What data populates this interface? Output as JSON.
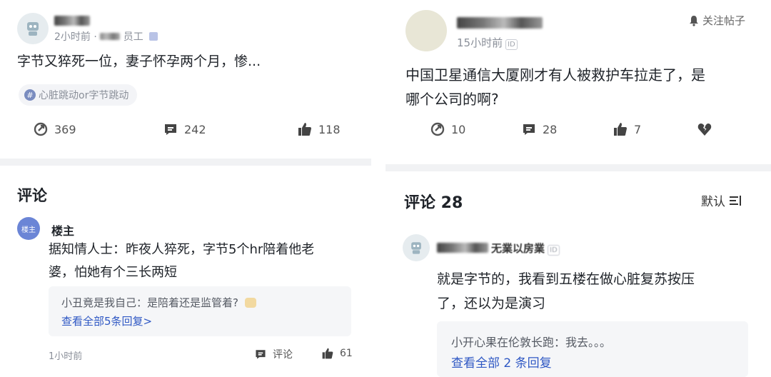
{
  "left_post": {
    "author_suffix": "员工",
    "time_prefix": "2小时前 ·",
    "content": "字节又猝死一位，妻子怀孕两个月，惨...",
    "tag": "心脏跳动or字节跳动",
    "stats": {
      "views": "369",
      "comments": "242",
      "likes": "118"
    }
  },
  "left_comments": {
    "heading": "评论",
    "op_avatar_label": "楼主",
    "op_name": "楼主",
    "op_text_line1": "据知情人士：昨夜人猝死，字节5个hr陪着他老",
    "op_text_line2": "婆，怕她有个三长两短",
    "reply": "小丑竟是我自己：是陪着还是监管着?",
    "view_all": "查看全部5条回复>",
    "time": "1小时前",
    "comment_label": "评论",
    "likes": "61"
  },
  "right_post": {
    "follow_label": "关注帖子",
    "time": "15小时前",
    "id_badge": "ID",
    "content_line1": "中国卫星通信大厦刚才有人被救护车拉走了，是",
    "content_line2": "哪个公司的啊?",
    "stats": {
      "views": "10",
      "comments": "28",
      "likes": "7"
    }
  },
  "right_comments": {
    "heading": "评论 28",
    "sort_label": "默认",
    "commenter_name_visible": "无業以房業",
    "id_badge": "ID",
    "text_line1": "就是字节的，我看到五楼在做心脏复苏按压",
    "text_line2": "了，还以为是演习",
    "reply": "小开心果在伦敦长跑：我去。。。",
    "view_all": "查看全部 2 条回复"
  },
  "colors": {
    "link": "#2f58c4",
    "divider": "#f1f2f4",
    "meta": "#8a8f99"
  }
}
